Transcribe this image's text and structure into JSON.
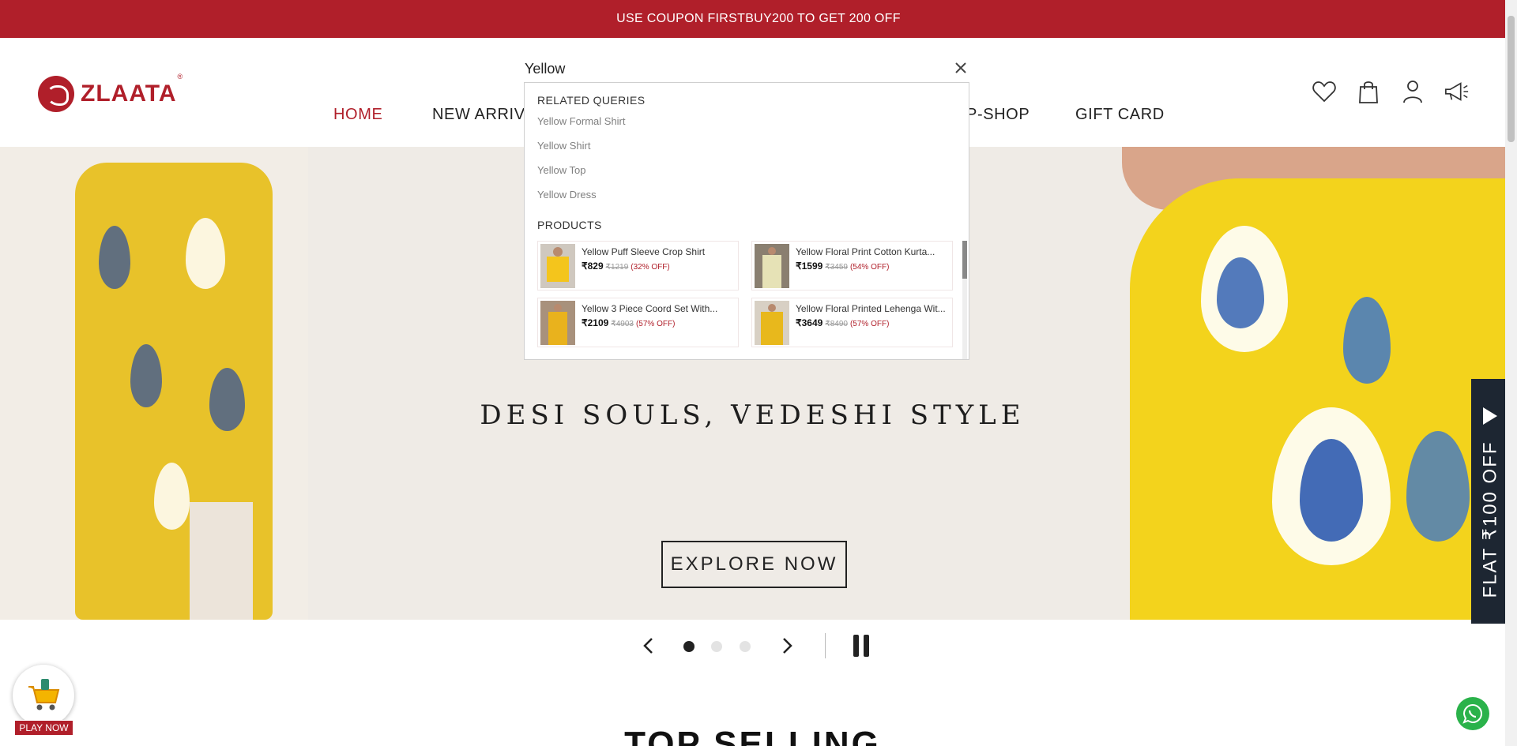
{
  "promo": {
    "text": "USE COUPON FIRSTBUY200 TO GET 200 OFF"
  },
  "brand": {
    "name": "ZLAATA",
    "registered": "®",
    "accent": "#b01f2a"
  },
  "nav": {
    "items": [
      {
        "label": "HOME",
        "active": true
      },
      {
        "label": "NEW ARRIV",
        "active": false
      },
      {
        "label": "P-SHOP",
        "active": false
      },
      {
        "label": "GIFT CARD",
        "active": false
      }
    ]
  },
  "header_icons": [
    "heart-icon",
    "bag-icon",
    "user-icon",
    "megaphone-icon"
  ],
  "search": {
    "value": "Yellow",
    "clear_icon": "close-icon"
  },
  "suggestions": {
    "related_heading": "RELATED QUERIES",
    "queries": [
      "Yellow Formal Shirt",
      "Yellow Shirt",
      "Yellow Top",
      "Yellow Dress"
    ],
    "products_heading": "PRODUCTS",
    "products": [
      {
        "name": "Yellow Puff Sleeve Crop Shirt",
        "price": "₹829",
        "was": "₹1219",
        "off": "(32% OFF)"
      },
      {
        "name": "Yellow Floral Print Cotton Kurta...",
        "price": "₹1599",
        "was": "₹3459",
        "off": "(54% OFF)"
      },
      {
        "name": "Yellow 3 Piece Coord Set With...",
        "price": "₹2109",
        "was": "₹4903",
        "off": "(57% OFF)"
      },
      {
        "name": "Yellow Floral Printed Lehenga Wit...",
        "price": "₹3649",
        "was": "₹8490",
        "off": "(57% OFF)"
      }
    ]
  },
  "hero": {
    "title": "DESI SOULS, VEDESHI STYLE",
    "cta": "EXPLORE NOW",
    "slides": 3,
    "active_slide": 1
  },
  "side_tab": {
    "text": "FLAT ₹100 OFF"
  },
  "section": {
    "title": "TOP SELLING"
  },
  "game": {
    "label": "PLAY NOW"
  }
}
